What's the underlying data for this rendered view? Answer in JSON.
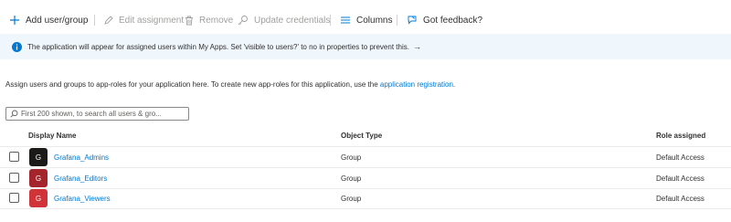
{
  "toolbar": {
    "add_label": "Add user/group",
    "edit_label": "Edit assignment",
    "remove_label": "Remove",
    "update_label": "Update credentials",
    "columns_label": "Columns",
    "feedback_label": "Got feedback?"
  },
  "banner": {
    "text": "The application will appear for assigned users within My Apps. Set 'visible to users?' to no in properties to prevent this.",
    "arrow": "→"
  },
  "description": {
    "text": "Assign users and groups to app-roles for your application here. To create new app-roles for this application, use the ",
    "link": "application registration",
    "suffix": "."
  },
  "search": {
    "placeholder": "First 200 shown, to search all users & gro..."
  },
  "table": {
    "headers": {
      "name": "Display Name",
      "type": "Object Type",
      "role": "Role assigned"
    },
    "rows": [
      {
        "initial": "G",
        "name": "Grafana_Admins",
        "type": "Group",
        "role": "Default Access",
        "avatar_color": "#1b1a19"
      },
      {
        "initial": "G",
        "name": "Grafana_Editors",
        "type": "Group",
        "role": "Default Access",
        "avatar_color": "#a4262c"
      },
      {
        "initial": "G",
        "name": "Grafana_Viewers",
        "type": "Group",
        "role": "Default Access",
        "avatar_color": "#d13438"
      }
    ]
  },
  "colors": {
    "accent": "#0078d4",
    "banner_bg": "#eff6fc",
    "disabled": "#a19f9d"
  }
}
